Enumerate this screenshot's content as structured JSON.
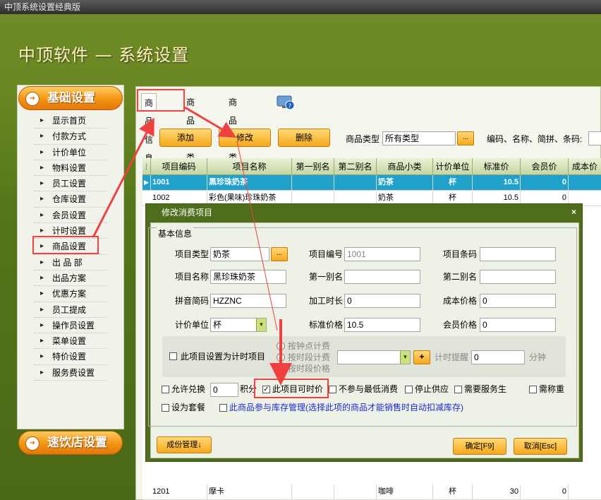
{
  "window_title": "中顶系统设置经典版",
  "app_title": "中顶软件 — 系统设置",
  "sidebar": {
    "section1": "基础设置",
    "section2": "速饮店设置",
    "items": [
      "显示首页",
      "付款方式",
      "计价单位",
      "物料设置",
      "员工设置",
      "仓库设置",
      "会员设置",
      "计时设置",
      "商品设置",
      "出 品 部",
      "出品方案",
      "优惠方案",
      "员工提成",
      "操作员设置",
      "菜单设置",
      "特价设置",
      "服务费设置"
    ]
  },
  "tabs": [
    "商品信息",
    "商品大类",
    "商品小类"
  ],
  "toolbar": {
    "add": "添加",
    "edit": "修改",
    "delete": "删除",
    "type_label": "商品类型",
    "type_value": "所有类型",
    "dots": "...",
    "search_label": "编码、名称、简拼、条码:"
  },
  "grid": {
    "headers": [
      "项目编码",
      "项目名称",
      "第一别名",
      "第二别名",
      "商品小类",
      "计价单位",
      "标准价",
      "会员价",
      "成本价"
    ],
    "rows": [
      {
        "code": "1001",
        "name": "黑珍珠奶茶",
        "alias1": "",
        "alias2": "",
        "category": "奶茶",
        "unit": "杯",
        "price": "10.5",
        "member": "0"
      },
      {
        "code": "1002",
        "name": "彩色(果味)珍珠奶茶",
        "alias1": "",
        "alias2": "",
        "category": "奶茶",
        "unit": "杯",
        "price": "10.5",
        "member": "0"
      },
      {
        "code": "1201",
        "name": "摩卡",
        "alias1": "",
        "alias2": "",
        "category": "咖啡",
        "unit": "杯",
        "price": "30",
        "member": "0"
      }
    ]
  },
  "dialog": {
    "title": "修改消费项目",
    "close": "×",
    "group": "基本信息",
    "labels": {
      "type": "项目类型",
      "code": "项目编号",
      "barcode": "项目条码",
      "name": "项目名称",
      "alias1": "第一别名",
      "alias2": "第二别名",
      "pinyin": "拼音简码",
      "process": "加工时长",
      "cost": "成本价格",
      "unit": "计价单位",
      "std_price": "标准价格",
      "member_price": "会员价格"
    },
    "values": {
      "type": "奶茶",
      "code": "1001",
      "barcode": "",
      "name": "黑珍珠奶茶",
      "alias1": "",
      "alias2": "",
      "pinyin": "HZZNC",
      "process": "0",
      "cost": "0",
      "unit": "杯",
      "std_price": "10.5",
      "member_price": "0"
    },
    "timer": {
      "checkbox": "此项目设置为计时项目",
      "radio1": "按钟点计费",
      "radio2": "按时段计费",
      "radio3": "按时段价格",
      "plus": "+",
      "remind_label": "计时提醒",
      "remind_value": "0",
      "minutes": "分钟"
    },
    "options": {
      "exchange": "允许兑换",
      "exchange_value": "0",
      "points": "积分",
      "concurrent": "此项目可时价",
      "no_min": "不参与最低消费",
      "stop": "停止供应",
      "service": "需要服务生",
      "weigh": "需称重",
      "package": "设为套餐",
      "inventory": "此商品参与库存管理(选择此项的商品才能销售时自动扣减库存)"
    },
    "buttons": {
      "components": "成份管理↓",
      "ok": "确定[F9]",
      "cancel": "取消[Esc]"
    }
  },
  "colors": {
    "accent_orange": "#f39311",
    "selected_row": "#1fa1cc",
    "annotation_red": "#f04040"
  }
}
